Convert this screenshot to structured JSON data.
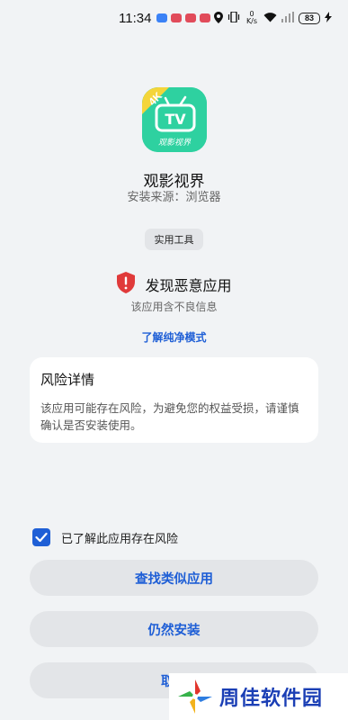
{
  "status_bar": {
    "time": "11:34",
    "net_speed": "0 K/s",
    "battery": "83",
    "icons": [
      "location-icon",
      "vibrate-icon",
      "network-speed",
      "wifi-icon",
      "signal-icon",
      "battery-icon",
      "charging-icon"
    ]
  },
  "app": {
    "name": "观影视界",
    "source": "安装来源：浏览器",
    "icon": "tv-app-icon",
    "icon_text_badge": "4K",
    "icon_text_main": "TV",
    "icon_text_caption": "观影视界",
    "icon_color": "#2ed1a0"
  },
  "category_tag": "实用工具",
  "warning": {
    "title": "发现恶意应用",
    "subtitle": "该应用含不良信息",
    "icon": "shield-warning-icon",
    "color": "#e03a3a"
  },
  "learn_more": "了解纯净模式",
  "risk": {
    "title": "风险详情",
    "text": "该应用可能存在风险，为避免您的权益受损，请谨慎确认是否安装使用。"
  },
  "consent": {
    "label": "已了解此应用存在风险",
    "checked": true
  },
  "buttons": {
    "find_similar": "查找类似应用",
    "install_anyway": "仍然安装",
    "cancel": "取消"
  },
  "watermark": {
    "text": "周佳软件园"
  },
  "colors": {
    "accent": "#1f5fd6",
    "background": "#f1f3f5",
    "button_bg": "#e3e5e8"
  }
}
